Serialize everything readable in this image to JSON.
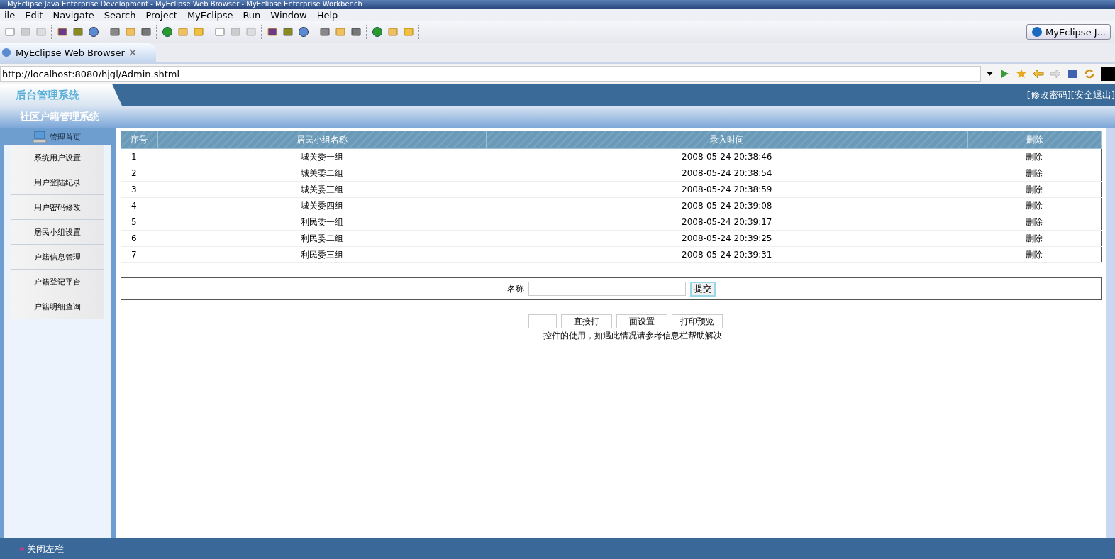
{
  "window": {
    "title": "MyEclipse Java Enterprise Development - MyEclipse Web Browser - MyEclipse Enterprise Workbench"
  },
  "menu": [
    "ile",
    "Edit",
    "Navigate",
    "Search",
    "Project",
    "MyEclipse",
    "Run",
    "Window",
    "Help"
  ],
  "perspective": {
    "label": "MyEclipse J..."
  },
  "editor_tab": {
    "label": "MyEclipse Web Browser",
    "selected": true
  },
  "address": {
    "value": "http://localhost:8080/hjgl/Admin.shtml"
  },
  "app": {
    "logo": "后台管理系统",
    "subtitle": "社区户籍管理系统",
    "header_links": [
      "[修改密码]",
      "[安全退出]"
    ]
  },
  "sidebar": {
    "home": "管理首页",
    "items": [
      "系统用户设置",
      "用户登陆纪录",
      "用户密码修改",
      "居民小组设置",
      "户籍信息管理",
      "户籍登记平台",
      "户籍明细查询"
    ]
  },
  "table": {
    "columns": [
      "序号",
      "居民小组名称",
      "录入时间",
      "删除"
    ],
    "rows": [
      [
        "1",
        "城关委一组",
        "2008-05-24 20:38:46",
        "删除"
      ],
      [
        "2",
        "城关委二组",
        "2008-05-24 20:38:54",
        "删除"
      ],
      [
        "3",
        "城关委三组",
        "2008-05-24 20:38:59",
        "删除"
      ],
      [
        "4",
        "城关委四组",
        "2008-05-24 20:39:08",
        "删除"
      ],
      [
        "5",
        "利民委一组",
        "2008-05-24 20:39:17",
        "删除"
      ],
      [
        "6",
        "利民委二组",
        "2008-05-24 20:39:25",
        "删除"
      ],
      [
        "7",
        "利民委三组",
        "2008-05-24 20:39:31",
        "删除"
      ]
    ]
  },
  "form": {
    "label": "名称",
    "submit": "提交"
  },
  "print_buttons": [
    "直接打",
    "面设置",
    "打印预览"
  ],
  "note": "控件的使用，如遇此情况请参考信息栏帮助解决",
  "footer": {
    "toggle": "关闭左栏"
  }
}
